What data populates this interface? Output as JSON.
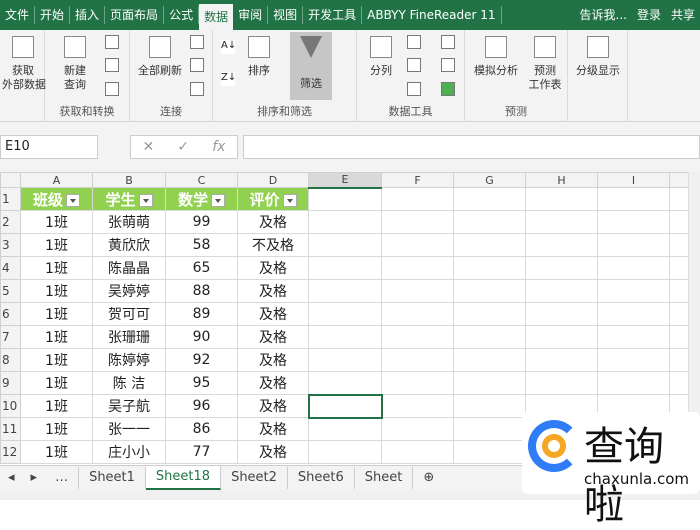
{
  "tabs": [
    "文件",
    "开始",
    "插入",
    "页面布局",
    "公式",
    "数据",
    "审阅",
    "视图",
    "开发工具",
    "ABBYY FineReader 11"
  ],
  "tell_me": "告诉我...",
  "login": "登录",
  "share": "共享",
  "ribbon": {
    "get_external": "获取\n外部数据",
    "new_query": "新建\n查询",
    "refresh_all": "全部刷新",
    "sort": "排序",
    "filter": "筛选",
    "text_to_columns": "分列",
    "what_if": "模拟分析",
    "forecast_sheet": "预测\n工作表",
    "outline": "分级显示",
    "groups": [
      "获取和转换",
      "连接",
      "排序和筛选",
      "数据工具",
      "预测"
    ]
  },
  "name_box": "E10",
  "fx": "fx",
  "columns": [
    "A",
    "B",
    "C",
    "D",
    "E",
    "F",
    "G",
    "H",
    "I"
  ],
  "headers": [
    "班级",
    "学生",
    "数学",
    "评价"
  ],
  "rows": [
    [
      "1班",
      "张萌萌",
      "99",
      "及格"
    ],
    [
      "1班",
      "黄欣欣",
      "58",
      "不及格"
    ],
    [
      "1班",
      "陈晶晶",
      "65",
      "及格"
    ],
    [
      "1班",
      "吴婷婷",
      "88",
      "及格"
    ],
    [
      "1班",
      "贺可可",
      "89",
      "及格"
    ],
    [
      "1班",
      "张珊珊",
      "90",
      "及格"
    ],
    [
      "1班",
      "陈婷婷",
      "92",
      "及格"
    ],
    [
      "1班",
      "陈  洁",
      "95",
      "及格"
    ],
    [
      "1班",
      "吴子航",
      "96",
      "及格"
    ],
    [
      "1班",
      "张一一",
      "86",
      "及格"
    ],
    [
      "1班",
      "庄小小",
      "77",
      "及格"
    ]
  ],
  "sheets": [
    "Sheet1",
    "Sheet18",
    "Sheet2",
    "Sheet6",
    "Sheet"
  ],
  "active_sheet": "Sheet18",
  "watermark": {
    "cn": "查询啦",
    "en": "chaxunla.com"
  }
}
